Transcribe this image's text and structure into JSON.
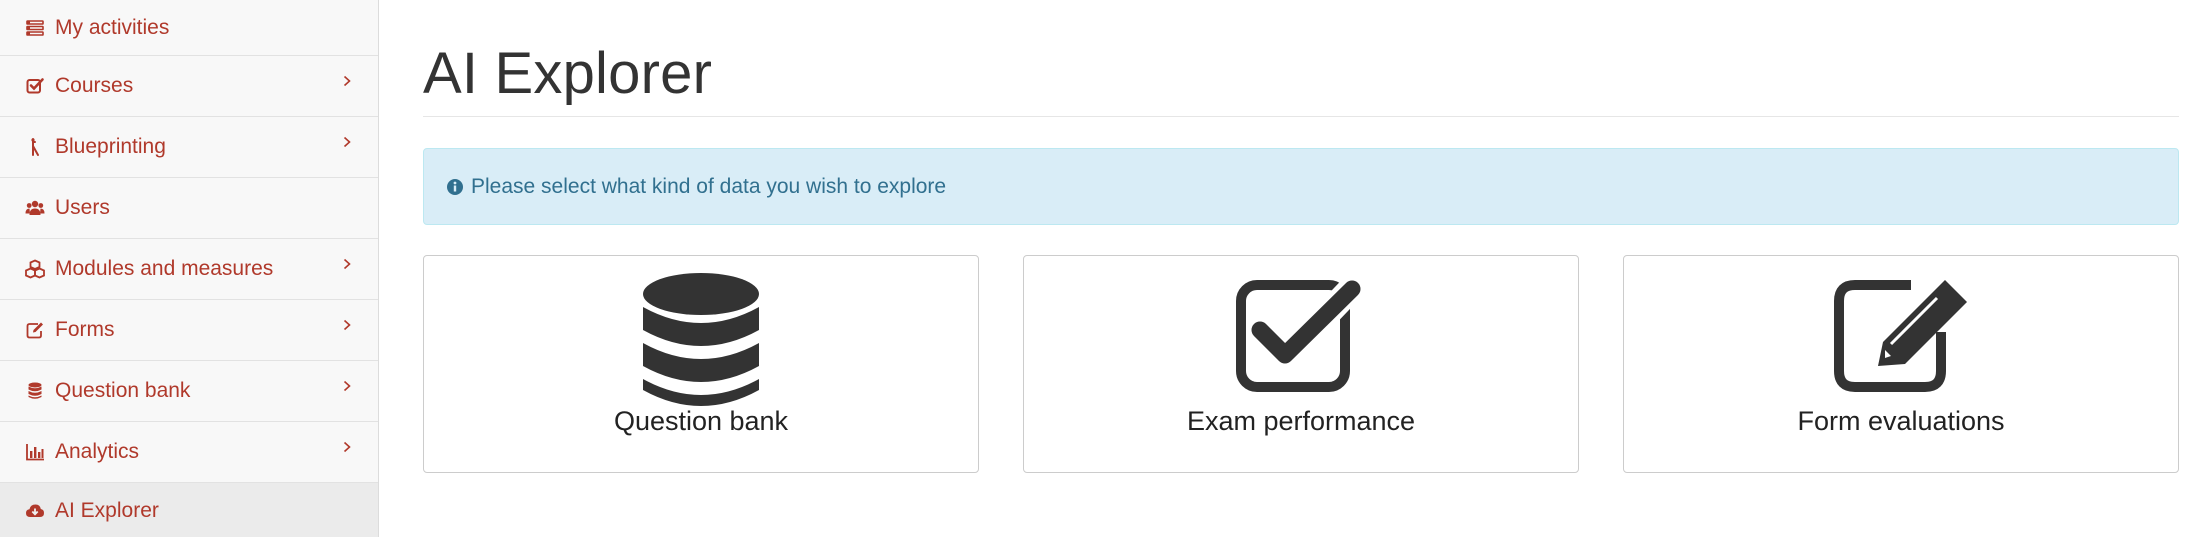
{
  "sidebar": {
    "items": [
      {
        "label": "My activities",
        "icon": "list-icon",
        "has_submenu": false
      },
      {
        "label": "Courses",
        "icon": "check-square-icon",
        "has_submenu": true
      },
      {
        "label": "Blueprinting",
        "icon": "blueprint-icon",
        "has_submenu": true
      },
      {
        "label": "Users",
        "icon": "users-icon",
        "has_submenu": false
      },
      {
        "label": "Modules and measures",
        "icon": "cubes-icon",
        "has_submenu": true
      },
      {
        "label": "Forms",
        "icon": "edit-icon",
        "has_submenu": true
      },
      {
        "label": "Question bank",
        "icon": "database-icon",
        "has_submenu": true
      },
      {
        "label": "Analytics",
        "icon": "bar-chart-icon",
        "has_submenu": true
      },
      {
        "label": "AI Explorer",
        "icon": "cloud-download-icon",
        "has_submenu": false,
        "active": true
      }
    ]
  },
  "main": {
    "title": "AI Explorer",
    "alert": {
      "text": "Please select what kind of data you wish to explore",
      "icon": "info-circle-icon"
    },
    "cards": [
      {
        "label": "Question bank",
        "icon": "database-icon"
      },
      {
        "label": "Exam performance",
        "icon": "check-square-icon"
      },
      {
        "label": "Form evaluations",
        "icon": "edit-icon"
      }
    ]
  },
  "colors": {
    "sidebar_link": "#b0392b",
    "alert_bg": "#d9edf7",
    "alert_text": "#31708f",
    "title_text": "#333333",
    "icon_dark": "#333333"
  }
}
